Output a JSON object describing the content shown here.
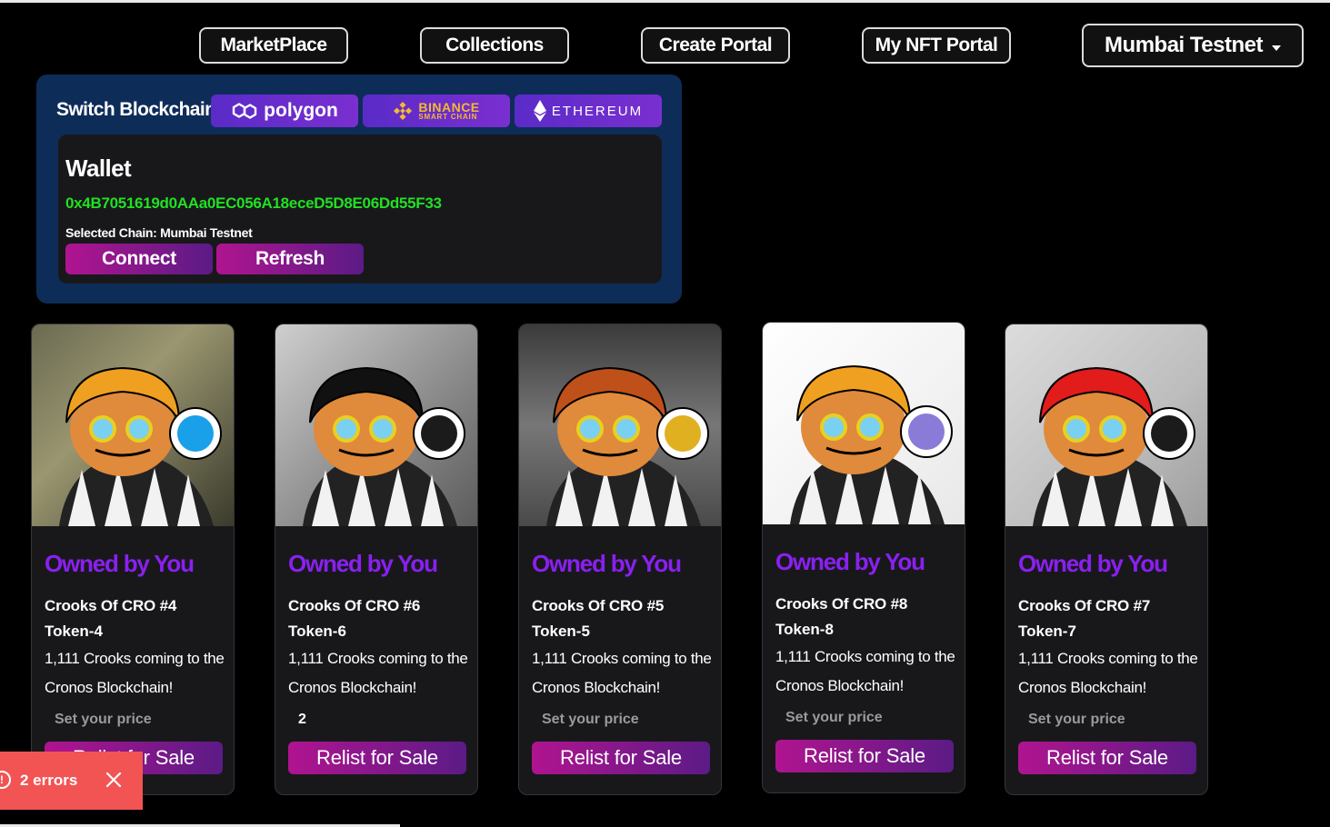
{
  "nav": {
    "marketplace": "MarketPlace",
    "collections": "Collections",
    "create_portal": "Create Portal",
    "my_nft_portal": "My NFT Portal",
    "network": "Mumbai Testnet"
  },
  "panel": {
    "switch_label": "Switch Blockchain",
    "chains": {
      "polygon": "polygon",
      "binance_line1": "BINANCE",
      "binance_line2": "SMART CHAIN",
      "ethereum": "ETHEREUM"
    },
    "wallet_title": "Wallet",
    "wallet_address": "0x4B7051619d0AAa0EC056A18eceD5D8E06Dd55F33",
    "selected_chain": "Selected Chain: Mumbai Testnet",
    "connect_label": "Connect",
    "refresh_label": "Refresh"
  },
  "cards": [
    {
      "owned": "Owned by You",
      "name": "Crooks Of CRO #4",
      "token": "Token-4",
      "desc": "1,111 Crooks coming to the Cronos Blockchain!",
      "price": "Set your price",
      "button": "Relist for Sale",
      "coin_icon": "sandbox-coin-icon"
    },
    {
      "owned": "Owned by You",
      "name": "Crooks Of CRO #6",
      "token": "Token-6",
      "desc": "1,111 Crooks coming to the Cronos Blockchain!",
      "price": "2",
      "button": "Relist for Sale",
      "coin_icon": "cronos-coin-icon"
    },
    {
      "owned": "Owned by You",
      "name": "Crooks Of CRO #5",
      "token": "Token-5",
      "desc": "1,111 Crooks coming to the Cronos Blockchain!",
      "price": "Set your price",
      "button": "Relist for Sale",
      "coin_icon": "solana-coin-icon"
    },
    {
      "owned": "Owned by You",
      "name": "Crooks Of CRO #8",
      "token": "Token-8",
      "desc": "1,111 Crooks coming to the Cronos Blockchain!",
      "price": "Set your price",
      "button": "Relist for Sale",
      "coin_icon": "litecoin-coin-icon"
    },
    {
      "owned": "Owned by You",
      "name": "Crooks Of CRO #7",
      "token": "Token-7",
      "desc": "1,111 Crooks coming to the Cronos Blockchain!",
      "price": "Set your price",
      "button": "Relist for Sale",
      "coin_icon": "cronos-coin-icon"
    }
  ],
  "error_toast": {
    "count_text": "2 errors",
    "icon": "!"
  },
  "colors": {
    "accent_purple": "#8a20f0",
    "wallet_green": "#22e022",
    "panel_bg": "#0e2c58",
    "error_red": "#f25454"
  }
}
